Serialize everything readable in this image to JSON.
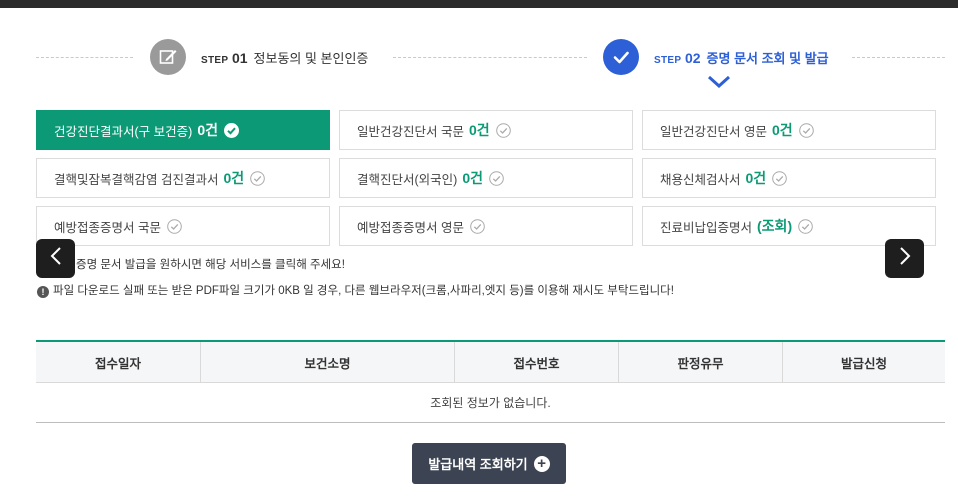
{
  "steps": [
    {
      "prefix": "STEP",
      "number": "01",
      "label": "정보동의 및 본인인증",
      "state": "done",
      "icon": "edit-icon"
    },
    {
      "prefix": "STEP",
      "number": "02",
      "label": "증명 문서 조회 및 발급",
      "state": "active",
      "icon": "check-icon"
    }
  ],
  "documents": [
    {
      "name": "건강진단결과서(구 보건증)",
      "count": "0건",
      "selected": true
    },
    {
      "name": "일반건강진단서 국문",
      "count": "0건",
      "selected": false
    },
    {
      "name": "일반건강진단서 영문",
      "count": "0건",
      "selected": false
    },
    {
      "name": "결핵및잠복결핵감염 검진결과서",
      "count": "0건",
      "selected": false
    },
    {
      "name": "결핵진단서(외국인)",
      "count": "0건",
      "selected": false
    },
    {
      "name": "채용신체검사서",
      "count": "0건",
      "selected": false
    },
    {
      "name": "예방접종증명서 국문",
      "count": "",
      "selected": false
    },
    {
      "name": "예방접종증명서 영문",
      "count": "",
      "selected": false
    },
    {
      "name": "진료비납입증명서",
      "count": "(조회)",
      "selected": false
    }
  ],
  "notices": {
    "line1": "증명 문서 발급을 원하시면 해당 서비스를 클릭해 주세요!",
    "line2": "파일 다운로드 실패 또는 받은 PDF파일 크기가 0KB 일 경우, 다른 웹브라우저(크롬,사파리,엣지 등)를 이용해 재시도 부탁드립니다!"
  },
  "table": {
    "headers": [
      "접수일자",
      "보건소명",
      "접수번호",
      "판정유무",
      "발급신청"
    ],
    "empty_message": "조회된 정보가 없습니다."
  },
  "history_button": {
    "label": "발급내역 조회하기"
  },
  "colors": {
    "accent": "#0c9a76",
    "step_active": "#2d5fd6",
    "button_dark": "#3c4352"
  }
}
